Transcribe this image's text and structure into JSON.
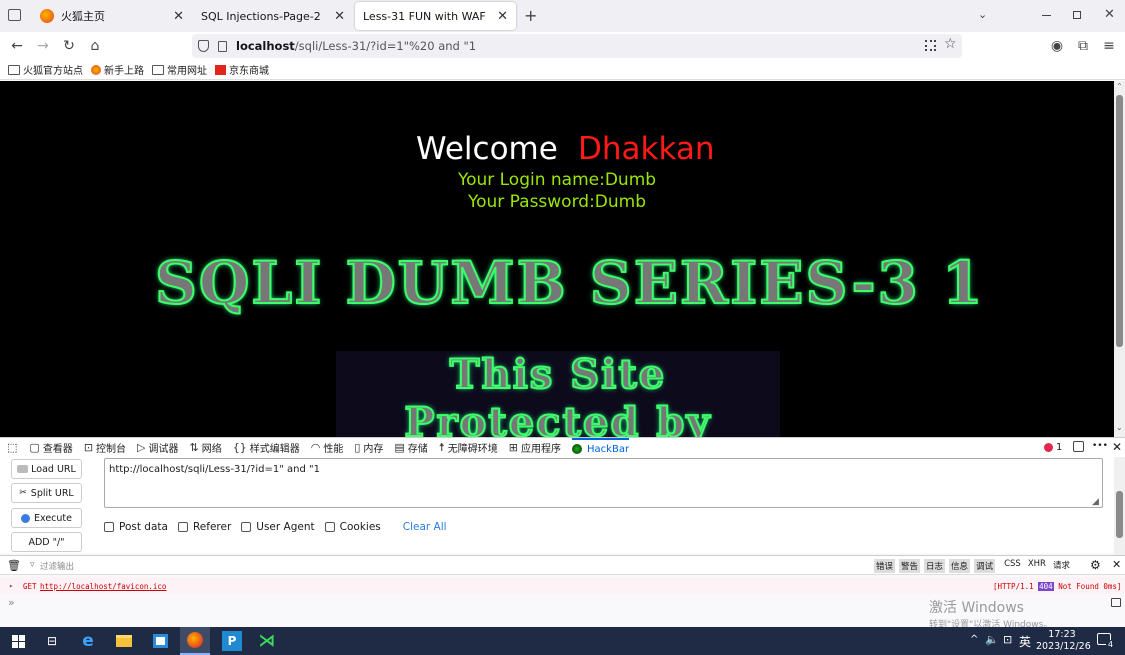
{
  "tabs": [
    {
      "label": "火狐主页",
      "close": "✕"
    },
    {
      "label": "SQL Injections-Page-2",
      "close": "✕"
    },
    {
      "label": "Less-31 FUN with WAF",
      "close": "✕"
    }
  ],
  "new_tab": "+",
  "url": {
    "host": "localhost",
    "path": "/sqli/Less-31/?id=1\"%20 and \"1"
  },
  "bookmarks": [
    "火狐官方站点",
    "新手上路",
    "常用网址",
    "京东商城"
  ],
  "page": {
    "welcome": "Welcome",
    "name": "Dhakkan",
    "login_line": "Your Login name:Dumb",
    "password_line": "Your Password:Dumb",
    "series_title": "SQLI DUMB SERIES-3 1",
    "protected_line1": "This Site",
    "protected_line2": "Protected by"
  },
  "devtools": {
    "tabs": [
      "查看器",
      "控制台",
      "调试器",
      "网络",
      "样式编辑器",
      "性能",
      "内存",
      "存储",
      "无障碍环境",
      "应用程序",
      "HackBar"
    ],
    "error_count": "1",
    "more": "•••",
    "close": "✕"
  },
  "hackbar": {
    "load_url": "Load URL",
    "split_url": "Split URL",
    "execute": "Execute",
    "add_slash": "ADD \"/\"",
    "url_value": "http://localhost/sqli/Less-31/?id=1\"  and \"1",
    "options": [
      "Post data",
      "Referer",
      "User Agent",
      "Cookies"
    ],
    "clear_all": "Clear All"
  },
  "console": {
    "filter_placeholder": "过滤输出",
    "filters": [
      "错误",
      "警告",
      "日志",
      "信息",
      "调试",
      "CSS",
      "XHR",
      "请求"
    ],
    "entry_method": "GET",
    "entry_url": "http://localhost/favicon.ico",
    "entry_status_prefix": "[HTTP/1.1",
    "entry_status_code": "404",
    "entry_status_suffix": "Not Found 0ms]",
    "prompt": "»"
  },
  "watermark": {
    "line1": "激活 Windows",
    "line2": "转到\"设置\"以激活 Windows。"
  },
  "taskbar": {
    "time": "17:23",
    "date": "2023/12/26",
    "lang": "英",
    "notif_count": "4"
  }
}
